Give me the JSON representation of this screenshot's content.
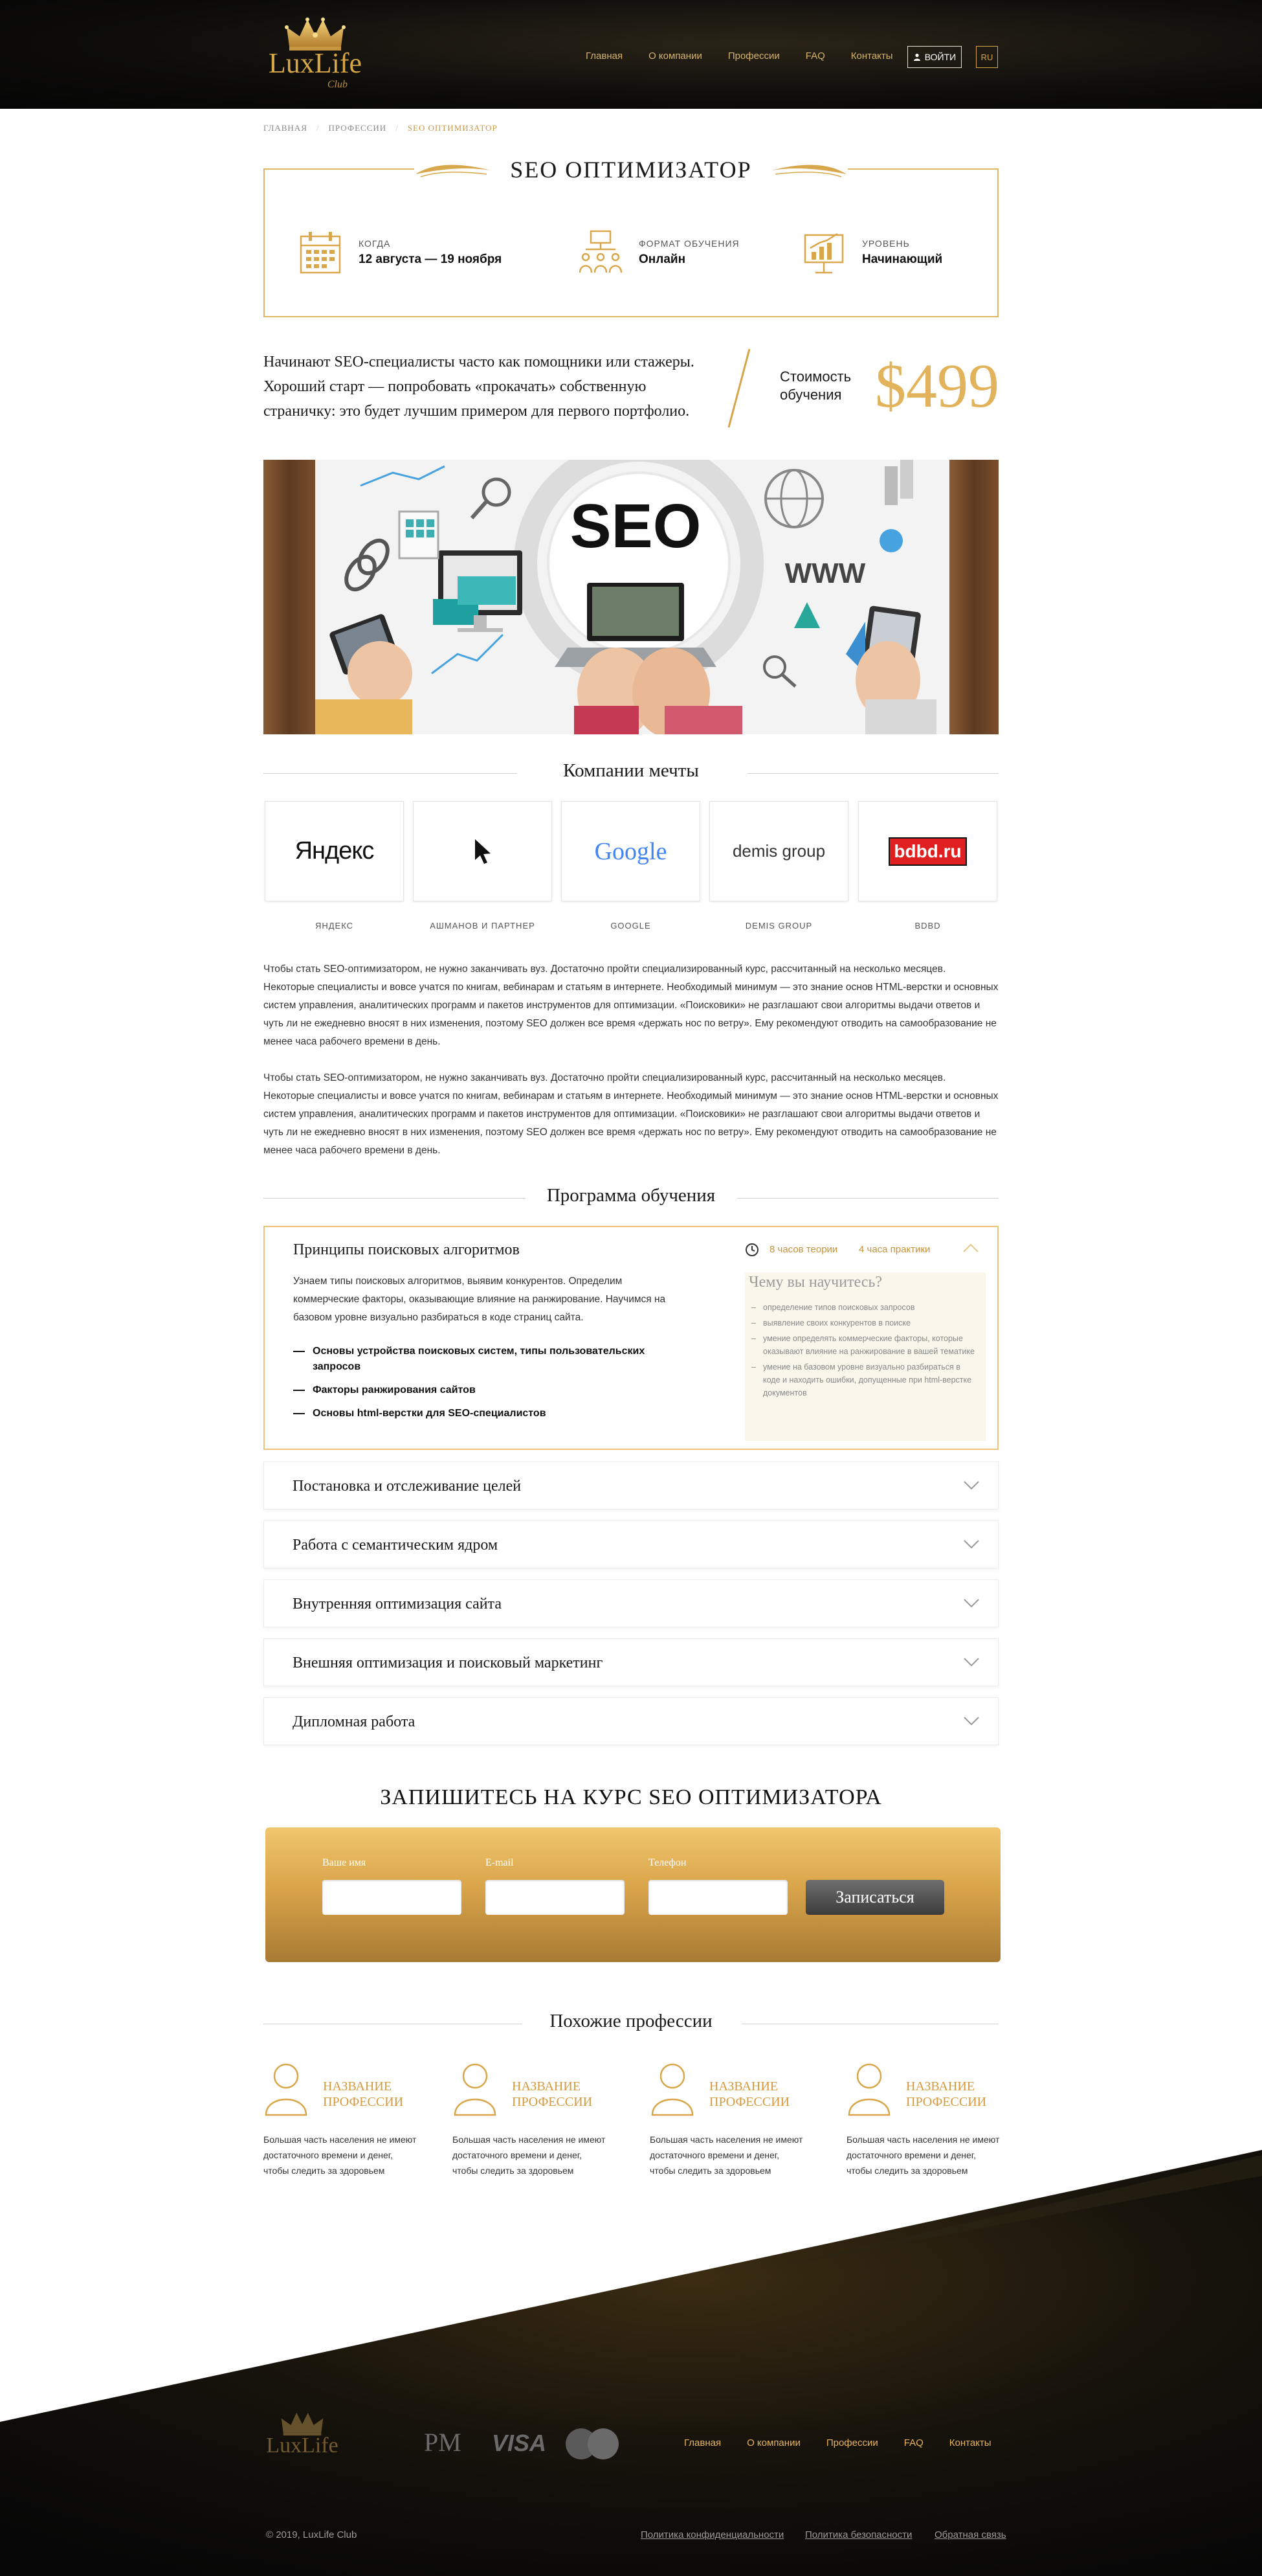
{
  "header": {
    "logo": "LuxLife",
    "logo_sub": "Club",
    "nav": [
      "Главная",
      "О компании",
      "Профессии",
      "FAQ",
      "Контакты"
    ],
    "login_label": "ВОЙТИ",
    "lang": "RU"
  },
  "breadcrumb": [
    "ГЛАВНАЯ",
    "ПРОФЕССИИ",
    "SEO ОПТИМИЗАТОР"
  ],
  "course": {
    "title": "SEO ОПТИМИЗАТОР",
    "when_label": "КОГДА",
    "when_value": "12 августа — 19 ноября",
    "format_label": "ФОРМАТ ОБУЧЕНИЯ",
    "format_value": "Онлайн",
    "level_label": "УРОВЕНЬ",
    "level_value": "Начинающий",
    "intro": "Начинают SEO-специалисты часто как помощники или стажеры. Хороший старт — попробовать «прокачать» собственную страничку: это будет лучшим примером для первого портфолио.",
    "price_label": "Стоимость обучения",
    "price_value": "$499"
  },
  "hero": {
    "seo": "SEO",
    "www": "WWW"
  },
  "companies": {
    "heading": "Компании мечты",
    "items": [
      {
        "name": "ЯНДЕКС",
        "logo": "Яндекс"
      },
      {
        "name": "АШМАНОВ И ПАРТНЕР",
        "logo": ""
      },
      {
        "name": "GOOGLE",
        "logo": "Google"
      },
      {
        "name": "DEMIS GROUP",
        "logo": "demis group"
      },
      {
        "name": "BDBD",
        "logo": "bdbd.ru"
      }
    ]
  },
  "paragraphs": [
    "Чтобы стать SEO-оптимизатором, не нужно заканчивать вуз. Достаточно пройти специализированный курс, рассчитанный на несколько месяцев. Некоторые специалисты и вовсе учатся по книгам, вебинарам и статьям в интернете. Необходимый минимум — это знание основ HTML-верстки и основных систем управления, аналитических программ и пакетов инструментов для оптимизации. «Поисковики» не разглашают свои алгоритмы выдачи ответов и чуть ли не ежедневно вносят в них изменения, поэтому SEO должен все время «держать нос по ветру». Ему рекомендуют отводить на самообразование не менее часа рабочего времени в день.",
    "Чтобы стать SEO-оптимизатором, не нужно заканчивать вуз. Достаточно пройти специализированный курс, рассчитанный на несколько месяцев. Некоторые специалисты и вовсе учатся по книгам, вебинарам и статьям в интернете. Необходимый минимум — это знание основ HTML-верстки и основных систем управления, аналитических программ и пакетов инструментов для оптимизации. «Поисковики» не разглашают свои алгоритмы выдачи ответов и чуть ли не ежедневно вносят в них изменения, поэтому SEO должен все время «держать нос по ветру». Ему рекомендуют отводить на самообразование не менее часа рабочего времени в день."
  ],
  "program": {
    "heading": "Программа обучения",
    "open": {
      "title": "Принципы поисковых алгоритмов",
      "theory": "8 часов теории",
      "practice": "4 часа практики",
      "description": "Узнаем типы поисковых алгоритмов, выявим конкурентов. Определим коммерческие факторы, оказывающие влияние на ранжирование. Научимся на базовом уровне визуально разбираться в коде страниц сайта.",
      "topics": [
        "Основы устройства поисковых систем, типы пользовательских запросов",
        "Факторы ранжирования сайтов",
        "Основы html-верстки для SEO-специалистов"
      ],
      "learn_title": "Чему вы научитесь?",
      "learn_items": [
        "определение типов поисковых запросов",
        "выявление своих конкурентов в поиске",
        "умение определять коммерческие факторы, которые оказывают влияние на ранжирование в вашей тематике",
        "умение на базовом уровне визуально разбираться в коде и находить ошибки, допущенные при html-верстке документов"
      ]
    },
    "items": [
      "Постановка и отслеживание целей",
      "Работа с семантическим ядром",
      "Внутренняя оптимизация сайта",
      "Внешняя оптимизация и поисковый маркетинг",
      "Дипломная работа"
    ]
  },
  "signup": {
    "title": "ЗАПИШИТЕСЬ НА КУРС SEO ОПТИМИЗАТОРА",
    "name_label": "Ваше имя",
    "email_label": "E-mail",
    "phone_label": "Телефон",
    "submit": "Записаться"
  },
  "similar": {
    "heading": "Похожие профессии",
    "items": [
      {
        "title": "НАЗВАНИЕ ПРОФЕССИИ",
        "text": "Большая часть населения не имеют достаточного времени и денег, чтобы следить за здоровьем"
      },
      {
        "title": "НАЗВАНИЕ ПРОФЕССИИ",
        "text": "Большая часть населения не имеют достаточного времени и денег, чтобы следить за здоровьем"
      },
      {
        "title": "НАЗВАНИЕ ПРОФЕССИИ",
        "text": "Большая часть населения не имеют достаточного времени и денег, чтобы следить за здоровьем"
      },
      {
        "title": "НАЗВАНИЕ ПРОФЕССИИ",
        "text": "Большая часть населения не имеют достаточного времени и денег, чтобы следить за здоровьем"
      }
    ]
  },
  "footer": {
    "logo": "LuxLife",
    "pm": "PM",
    "visa": "VISA",
    "nav": [
      "Главная",
      "О компании",
      "Профессии",
      "FAQ",
      "Контакты"
    ],
    "copyright": "© 2019, LuxLife Club",
    "privacy": "Политика конфиденциальности",
    "security": "Политика безопасности",
    "feedback": "Обратная связь"
  },
  "colors": {
    "gold": "#e2b35a",
    "dark": "#0d0c0a"
  }
}
